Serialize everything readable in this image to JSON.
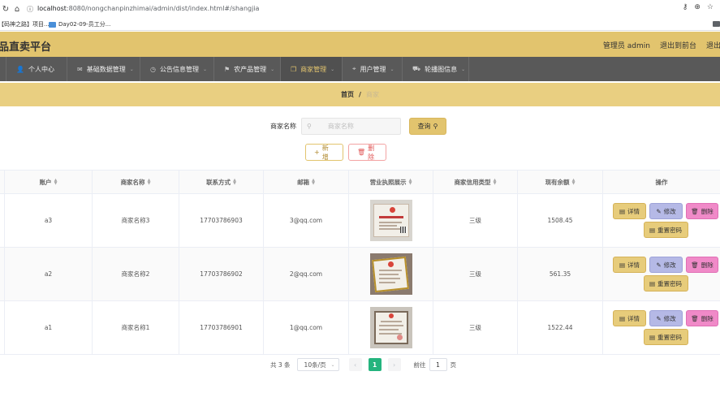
{
  "browser": {
    "url_host": "localhost",
    "url_rest": ":8080/nongchanpinzhimai/admin/dist/index.html#/shangjia",
    "bookmarks": [
      "【码神之路】项目...",
      "Day02-09-员工分..."
    ]
  },
  "header": {
    "title": "品直卖平台",
    "user": "管理员 admin",
    "to_front": "退出到前台",
    "logout": "退出登"
  },
  "nav": {
    "items": [
      {
        "label": "个人中心",
        "icon": "user-icon"
      },
      {
        "label": "基础数据管理",
        "icon": "mail-icon"
      },
      {
        "label": "公告信息管理",
        "icon": "clock-icon"
      },
      {
        "label": "农产品管理",
        "icon": "flag-icon"
      },
      {
        "label": "商家管理",
        "icon": "copy-icon",
        "active": true
      },
      {
        "label": "用户管理",
        "icon": "location-icon"
      },
      {
        "label": "轮播图信息",
        "icon": "cart-icon"
      }
    ]
  },
  "breadcrumb": {
    "home": "首页",
    "sep": "/",
    "current": "商家"
  },
  "search": {
    "label": "商家名称",
    "placeholder": "商家名称",
    "button": "查询"
  },
  "actions": {
    "add": "新增",
    "delete": "删除"
  },
  "table": {
    "columns": [
      "账户",
      "商家名称",
      "联系方式",
      "邮箱",
      "营业执照展示",
      "商家信用类型",
      "现有余额",
      "操作"
    ],
    "rows": [
      {
        "account": "a3",
        "name": "商家名称3",
        "phone": "17703786903",
        "email": "3@qq.com",
        "credit": "三级",
        "balance": "1508.45"
      },
      {
        "account": "a2",
        "name": "商家名称2",
        "phone": "17703786902",
        "email": "2@qq.com",
        "credit": "三级",
        "balance": "561.35"
      },
      {
        "account": "a1",
        "name": "商家名称1",
        "phone": "17703786901",
        "email": "1@qq.com",
        "credit": "三级",
        "balance": "1522.44"
      }
    ],
    "ops": {
      "detail": "详情",
      "edit": "修改",
      "delete": "删除",
      "reset": "重置密码"
    }
  },
  "pagination": {
    "total": "共 3 条",
    "page_size": "10条/页",
    "current_page": "1",
    "goto_label": "前往",
    "goto_value": "1",
    "page_unit": "页"
  }
}
